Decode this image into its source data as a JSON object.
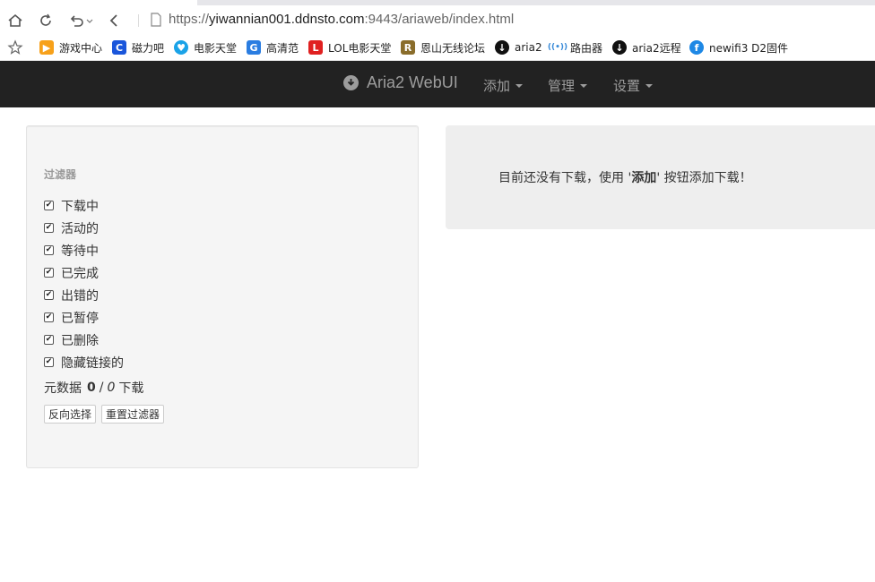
{
  "browser": {
    "url_prefix": "https://",
    "url_host": "yiwannian001.ddnsto.com",
    "url_rest": ":9443/ariaweb/index.html",
    "bookmarks": [
      {
        "label": "游戏中心",
        "icon": "game-center-icon",
        "color": "#f7a11a",
        "glyph": "▶"
      },
      {
        "label": "磁力吧",
        "icon": "cili-icon",
        "color": "#1a56db",
        "glyph": "C"
      },
      {
        "label": "电影天堂",
        "icon": "movie-heaven-icon",
        "color": "#1aa3e8",
        "glyph": "♥"
      },
      {
        "label": "高清范",
        "icon": "gaoqingfan-icon",
        "color": "#2a7de1",
        "glyph": "G"
      },
      {
        "label": "LOL电影天堂",
        "icon": "lol-movie-icon",
        "color": "#e02020",
        "glyph": "L"
      },
      {
        "label": "恩山无线论坛",
        "icon": "right-forum-icon",
        "color": "#8a6d2b",
        "glyph": "R"
      },
      {
        "label": "aria2",
        "icon": "download-circle-icon",
        "color": "#111111",
        "glyph": "↓"
      },
      {
        "label": "路由器",
        "icon": "router-wifi-icon",
        "color": "#ffffff",
        "glyph": "(•)"
      },
      {
        "label": "aria2远程",
        "icon": "download-circle-icon",
        "color": "#111111",
        "glyph": "↓"
      },
      {
        "label": "newifi3 D2固件",
        "icon": "newifi-icon",
        "color": "#1e88e5",
        "glyph": "f"
      }
    ]
  },
  "navbar": {
    "brand": "Aria2 WebUI",
    "menu": [
      "添加",
      "管理",
      "设置"
    ],
    "background": "#222222",
    "text_color": "#9d9d9d"
  },
  "filter_panel": {
    "title": "过滤器",
    "filters": [
      {
        "label": "下载中",
        "checked": true
      },
      {
        "label": "活动的",
        "checked": true
      },
      {
        "label": "等待中",
        "checked": true
      },
      {
        "label": "已完成",
        "checked": true
      },
      {
        "label": "出错的",
        "checked": true
      },
      {
        "label": "已暂停",
        "checked": true
      },
      {
        "label": "已删除",
        "checked": true
      },
      {
        "label": "隐藏链接的",
        "checked": true
      }
    ],
    "meta_prefix": "元数据",
    "meta_count": "0",
    "meta_sep": "/",
    "meta_total": "0",
    "meta_suffix": "下载",
    "invert_button": "反向选择",
    "reset_button": "重置过滤器"
  },
  "notice": {
    "text_before": "目前还没有下载，使用 '",
    "keyword": "添加",
    "text_after": "' 按钮添加下载！"
  }
}
